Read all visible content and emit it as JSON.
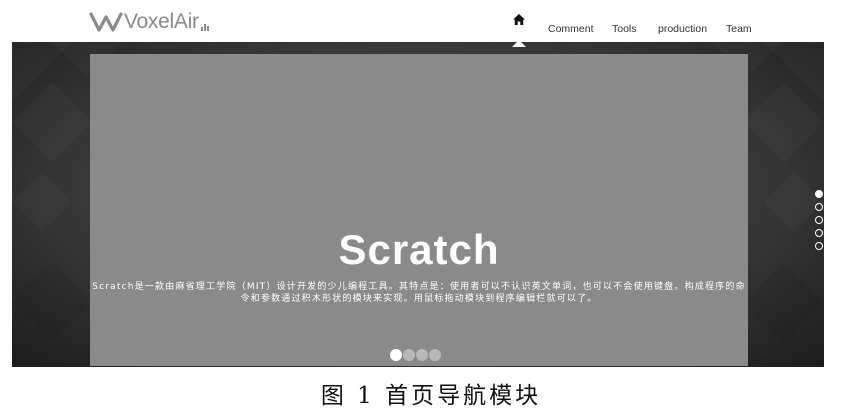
{
  "brand": {
    "name": "VoxelAir"
  },
  "nav": {
    "home_icon": "home-icon",
    "items": [
      "Comment",
      "Tools",
      "production",
      "Team"
    ]
  },
  "hero": {
    "title": "Scratch",
    "description": "Scratch是一款由麻省理工学院（MIT）设计开发的少儿编程工具。其特点是：使用者可以不认识英文单词，也可以不会使用键盘。构成程序的命令和参数通过积木形状的模块来实现。用鼠标拖动模块到程序编辑栏就可以了。",
    "slide_count": 4,
    "active_slide": 1,
    "section_count": 5,
    "active_section": 1
  },
  "caption": "图 1 首页导航模块",
  "colors": {
    "panel": "#8a8a8a",
    "background_dark": "#1c1c1c",
    "logo": "#8a8a8a"
  }
}
